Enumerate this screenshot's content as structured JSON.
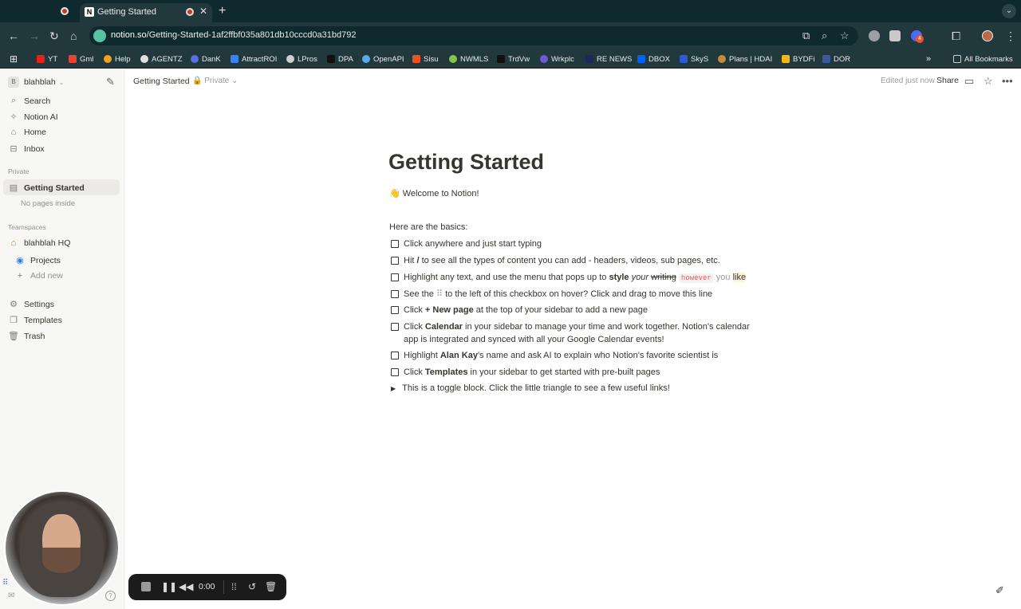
{
  "browser": {
    "tab_title": "Getting Started",
    "url_host": "notion.so",
    "url_path": "/Getting-Started-1af2ffbf035a801db10cccd0a31bd792",
    "bookmarks": [
      "YT",
      "Gml",
      "Help",
      "AGENTZ",
      "DanK",
      "AttractROI",
      "LPros",
      "DPA",
      "OpenAPI",
      "Sisu",
      "NWMLS",
      "TrdVw",
      "Wrkplc",
      "RE NEWS",
      "DBOX",
      "SkyS",
      "Plans | HDAI",
      "BYDFi",
      "DOR"
    ],
    "all_bookmarks": "All Bookmarks",
    "extension_badge": "4"
  },
  "sidebar": {
    "workspace": "blahblah",
    "workspace_initial": "B",
    "search": "Search",
    "notion_ai": "Notion AI",
    "home": "Home",
    "inbox": "Inbox",
    "private_label": "Private",
    "active_page": "Getting Started",
    "no_pages": "No pages inside",
    "teamspaces_label": "Teamspaces",
    "teamspace": "blahblah HQ",
    "projects": "Projects",
    "add_new": "Add new",
    "settings": "Settings",
    "templates": "Templates",
    "trash": "Trash"
  },
  "topbar": {
    "breadcrumb": "Getting Started",
    "privacy": "Private",
    "edited": "Edited just now",
    "share": "Share"
  },
  "page": {
    "title": "Getting Started",
    "welcome": "👋 Welcome to Notion!",
    "basics": "Here are the basics:",
    "todo1": "Click anywhere and just start typing",
    "todo2_a": "Hit ",
    "todo2_b": "/",
    "todo2_c": " to see all the types of content you can add - headers, videos, sub pages, etc.",
    "todo3_a": "Highlight any text, and use the menu that pops up to ",
    "todo3_style": "style",
    "todo3_your": "your",
    "todo3_writing": "writing",
    "todo3_however": "however",
    "todo3_you": "you",
    "todo3_like": "like",
    "todo4_a": "See the ",
    "todo4_handle": "⠿",
    "todo4_b": " to the left of this checkbox on hover? Click and drag to move this line",
    "todo5_a": "Click ",
    "todo5_b": "+ New page",
    "todo5_c": " at the top of your sidebar to add a new page",
    "todo6_a": "Click ",
    "todo6_b": "Calendar",
    "todo6_c": " in your sidebar to manage your time and work together. Notion's calendar app is integrated and synced with all your Google Calendar events!",
    "todo7_a": "Highlight ",
    "todo7_b": "Alan Kay",
    "todo7_c": "'s name and ask AI to explain who Notion's favorite scientist is",
    "todo8_a": "Click ",
    "todo8_b": "Templates",
    "todo8_c": " in your sidebar to get started with pre-built pages",
    "toggle": "This is a toggle block. Click the little triangle to see a few useful links!"
  },
  "recorder": {
    "time": "0:00"
  },
  "colors": {
    "chrome_dark": "#0f2a2e",
    "chrome_toolbar": "#21393d",
    "sidebar_bg": "#f7f7f5",
    "text": "#37352f",
    "code_red": "#eb5757"
  }
}
